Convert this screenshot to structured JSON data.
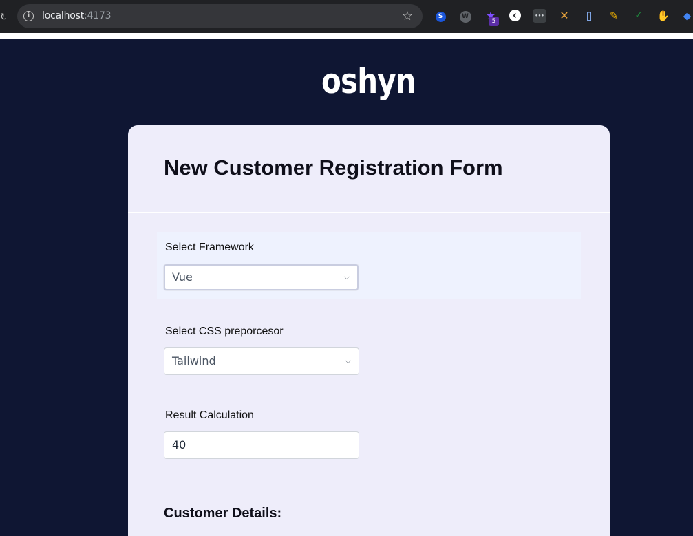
{
  "browser": {
    "url_host": "localhost",
    "url_port": ":4173",
    "extensions": [
      {
        "name": "s-extension-icon",
        "glyph": "S",
        "color": "#1a56db"
      },
      {
        "name": "w-extension-icon",
        "glyph": "W",
        "color": "#5f6368"
      },
      {
        "name": "puzzle-extension-icon",
        "glyph": "★",
        "color": "#5b2ea6"
      },
      {
        "name": "back-arrow-extension-icon",
        "glyph": "‹",
        "color": "#ffffff"
      },
      {
        "name": "dots-extension-icon",
        "glyph": "•••",
        "color": "#3c4043"
      },
      {
        "name": "cross-extension-icon",
        "glyph": "✕",
        "color": "#2b7a3b"
      },
      {
        "name": "clipboard-extension-icon",
        "glyph": "▯",
        "color": "#4285f4"
      },
      {
        "name": "broom-extension-icon",
        "glyph": "✎",
        "color": "#f4b400"
      },
      {
        "name": "check-extension-icon",
        "glyph": "✓",
        "color": "#1e8e3e"
      },
      {
        "name": "hand-extension-icon",
        "glyph": "✋",
        "color": "#f4b400"
      },
      {
        "name": "tag-extension-icon",
        "glyph": "◆",
        "color": "#4285f4"
      }
    ],
    "badge_count": "5"
  },
  "page": {
    "logo": "oshyn",
    "form_title": "New Customer Registration Form",
    "fields": [
      {
        "label": "Select Framework",
        "value": "Vue"
      },
      {
        "label": "Select CSS preporcesor",
        "value": "Tailwind"
      },
      {
        "label": "Result Calculation",
        "value": "40"
      }
    ],
    "section_title": "Customer Details:"
  },
  "colors": {
    "page_background": "#0f1633",
    "card_background": "#eeedfa",
    "highlight_background": "#eef2fe"
  }
}
